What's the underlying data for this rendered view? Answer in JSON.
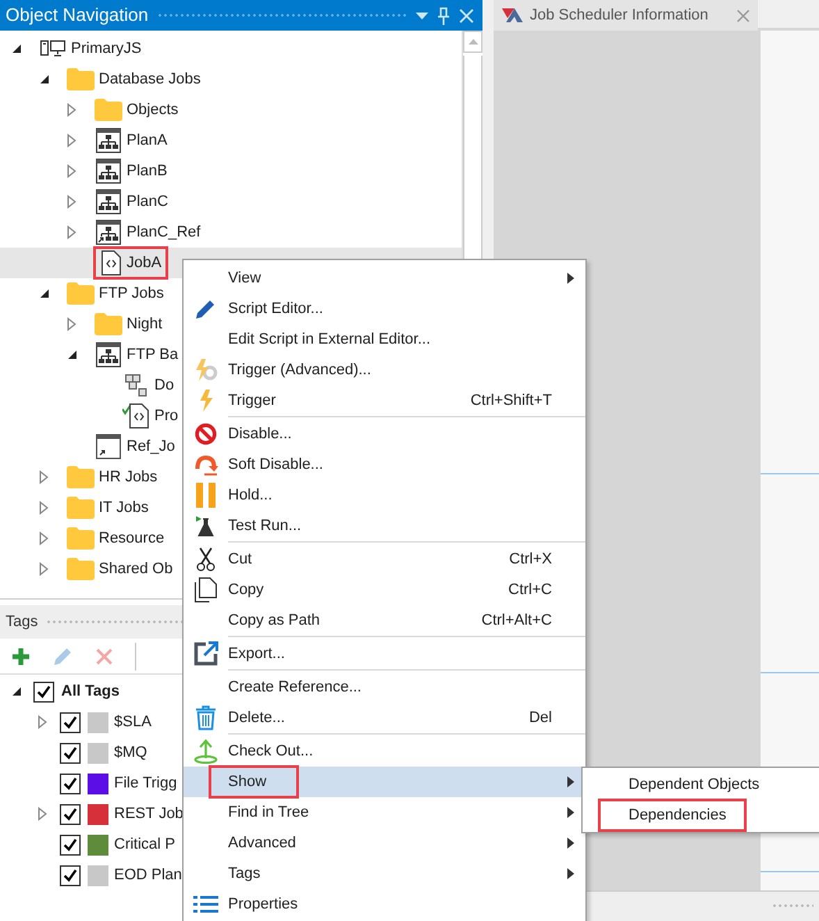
{
  "object_navigation": {
    "title": "Object Navigation",
    "tree": [
      {
        "label": "PrimaryJS",
        "kind": "server",
        "expanded": true,
        "selected": false,
        "children": [
          {
            "label": "Database Jobs",
            "kind": "folder",
            "expanded": true,
            "selected": false,
            "children": [
              {
                "label": "Objects",
                "kind": "folder",
                "expanded": false,
                "selected": false
              },
              {
                "label": "PlanA",
                "kind": "plan",
                "expanded": false,
                "selected": false
              },
              {
                "label": "PlanB",
                "kind": "plan",
                "expanded": false,
                "selected": false
              },
              {
                "label": "PlanC",
                "kind": "plan",
                "expanded": false,
                "selected": false
              },
              {
                "label": "PlanC_Ref",
                "kind": "plan_ref",
                "expanded": false,
                "selected": false
              },
              {
                "label": "JobA",
                "kind": "script",
                "selected": true,
                "marked": true
              }
            ]
          },
          {
            "label": "FTP Jobs",
            "kind": "folder",
            "expanded": true,
            "selected": false,
            "children": [
              {
                "label": "Night",
                "kind": "folder",
                "expanded": false,
                "selected": false
              },
              {
                "label": "FTP Ba",
                "kind": "plan",
                "expanded": true,
                "selected": false,
                "children": [
                  {
                    "label": "Do",
                    "kind": "cubes",
                    "selected": false
                  },
                  {
                    "label": "Pro",
                    "kind": "script_checked",
                    "selected": false
                  }
                ]
              },
              {
                "label": "Ref_Jo",
                "kind": "reference",
                "selected": false
              }
            ]
          },
          {
            "label": "HR Jobs",
            "kind": "folder",
            "expanded": false,
            "selected": false
          },
          {
            "label": "IT Jobs",
            "kind": "folder",
            "expanded": false,
            "selected": false
          },
          {
            "label": "Resource",
            "kind": "folder",
            "expanded": false,
            "selected": false
          },
          {
            "label": "Shared Ob",
            "kind": "folder",
            "expanded": false,
            "selected": false
          }
        ]
      }
    ]
  },
  "tags_panel": {
    "title": "Tags",
    "toolbar": [
      {
        "kind": "add",
        "disabled": false
      },
      {
        "kind": "edit",
        "disabled": true
      },
      {
        "kind": "delete",
        "disabled": true
      }
    ],
    "root": {
      "label": "All Tags",
      "expanded": true,
      "checked": true
    },
    "tags": [
      {
        "label": "$SLA",
        "color": "#c8c8c8",
        "checked": true,
        "expandable": true
      },
      {
        "label": "$MQ",
        "color": "#c8c8c8",
        "checked": true,
        "expandable": false
      },
      {
        "label": "File Trigg",
        "color": "#5b0ee6",
        "checked": true,
        "expandable": false
      },
      {
        "label": "REST Job",
        "color": "#d6303a",
        "checked": true,
        "expandable": true
      },
      {
        "label": "Critical P",
        "color": "#5e8c3a",
        "checked": true,
        "expandable": false
      },
      {
        "label": "EOD Plan",
        "color": "#c8c8c8",
        "checked": true,
        "expandable": false
      }
    ]
  },
  "document_tab": {
    "title": "Job Scheduler Information"
  },
  "context_menu": {
    "groups": [
      [
        {
          "label": "View",
          "submenu": true,
          "selected": false
        },
        {
          "label": "Script Editor...",
          "submenu": false,
          "selected": false
        },
        {
          "label": "Edit Script in External Editor...",
          "submenu": false,
          "selected": false
        },
        {
          "label": "Trigger (Advanced)...",
          "submenu": false,
          "selected": false
        },
        {
          "label": "Trigger",
          "shortcut": "Ctrl+Shift+T",
          "submenu": false,
          "selected": false
        }
      ],
      [
        {
          "label": "Disable...",
          "submenu": false,
          "selected": false
        },
        {
          "label": "Soft Disable...",
          "submenu": false,
          "selected": false
        },
        {
          "label": "Hold...",
          "submenu": false,
          "selected": false
        },
        {
          "label": "Test Run...",
          "submenu": false,
          "selected": false
        }
      ],
      [
        {
          "label": "Cut",
          "shortcut": "Ctrl+X",
          "submenu": false,
          "selected": false
        },
        {
          "label": "Copy",
          "shortcut": "Ctrl+C",
          "submenu": false,
          "selected": false
        },
        {
          "label": "Copy as Path",
          "shortcut": "Ctrl+Alt+C",
          "submenu": false,
          "selected": false
        }
      ],
      [
        {
          "label": "Export...",
          "submenu": false,
          "selected": false
        }
      ],
      [
        {
          "label": "Create Reference...",
          "submenu": false,
          "selected": false
        },
        {
          "label": "Delete...",
          "shortcut": "Del",
          "submenu": false,
          "selected": false
        }
      ],
      [
        {
          "label": "Check Out...",
          "submenu": false,
          "selected": false
        },
        {
          "label": "Show",
          "submenu": true,
          "selected": true,
          "marked": true
        },
        {
          "label": "Find in Tree",
          "submenu": true,
          "selected": false
        },
        {
          "label": "Advanced",
          "submenu": true,
          "selected": false
        },
        {
          "label": "Tags",
          "submenu": true,
          "selected": false
        },
        {
          "label": "Properties",
          "submenu": false,
          "selected": false
        }
      ]
    ]
  },
  "submenu": {
    "items": [
      {
        "label": "Dependent Objects",
        "selected": false
      },
      {
        "label": "Dependencies",
        "selected": false,
        "marked": true
      }
    ]
  }
}
